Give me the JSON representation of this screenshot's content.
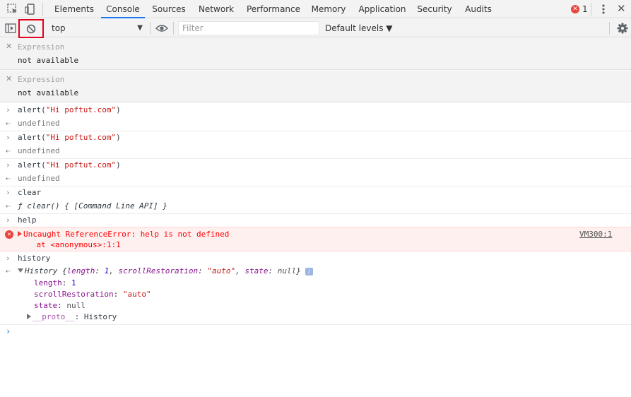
{
  "tabs": [
    {
      "label": "Elements"
    },
    {
      "label": "Console"
    },
    {
      "label": "Sources"
    },
    {
      "label": "Network"
    },
    {
      "label": "Performance"
    },
    {
      "label": "Memory"
    },
    {
      "label": "Application"
    },
    {
      "label": "Security"
    },
    {
      "label": "Audits"
    }
  ],
  "active_tab": "Console",
  "error_count": "1",
  "toolbar": {
    "context": "top",
    "filter_placeholder": "Filter",
    "levels_label": "Default levels ▼"
  },
  "expressions": [
    {
      "name": "Expression",
      "value": "not available"
    },
    {
      "name": "Expression",
      "value": "not available"
    }
  ],
  "console": {
    "cmd1": "alert(",
    "cmd1_str": "\"Hi poftut.com\"",
    "cmd_close": ")",
    "undefined": "undefined",
    "clear_cmd": "clear",
    "clear_result": "ƒ clear() { [Command Line API] }",
    "help_cmd": "help",
    "error_msg": "Uncaught ReferenceError: help is not defined",
    "error_loc": "    at <anonymous>:1:1",
    "error_source": "VM300:1",
    "history_cmd": "history",
    "history_obj_name": "History ",
    "history_summary_open": "{",
    "history_k1": "length",
    "history_v1": "1",
    "history_k2": "scrollRestoration",
    "history_v2": "\"auto\"",
    "history_k3": "state",
    "history_v3": "null",
    "history_summary_close": "}",
    "prop_length_key": "length",
    "prop_length_val": "1",
    "prop_scroll_key": "scrollRestoration",
    "prop_scroll_val": "\"auto\"",
    "prop_state_key": "state",
    "prop_state_val": "null",
    "prop_proto_key": "__proto__",
    "prop_proto_val": "History",
    "info_badge": "i"
  },
  "colors": {
    "accent": "#1a73e8",
    "error": "#e8453c",
    "string": "#c41a16",
    "highlight_box": "#e2001a"
  },
  "icons": [
    "inspect-element-icon",
    "device-toolbar-icon",
    "error-icon",
    "more-options-icon",
    "close-icon",
    "sidebar-toggle-icon",
    "clear-console-icon",
    "eye-icon",
    "settings-gear-icon",
    "prompt-chevron-icon"
  ]
}
